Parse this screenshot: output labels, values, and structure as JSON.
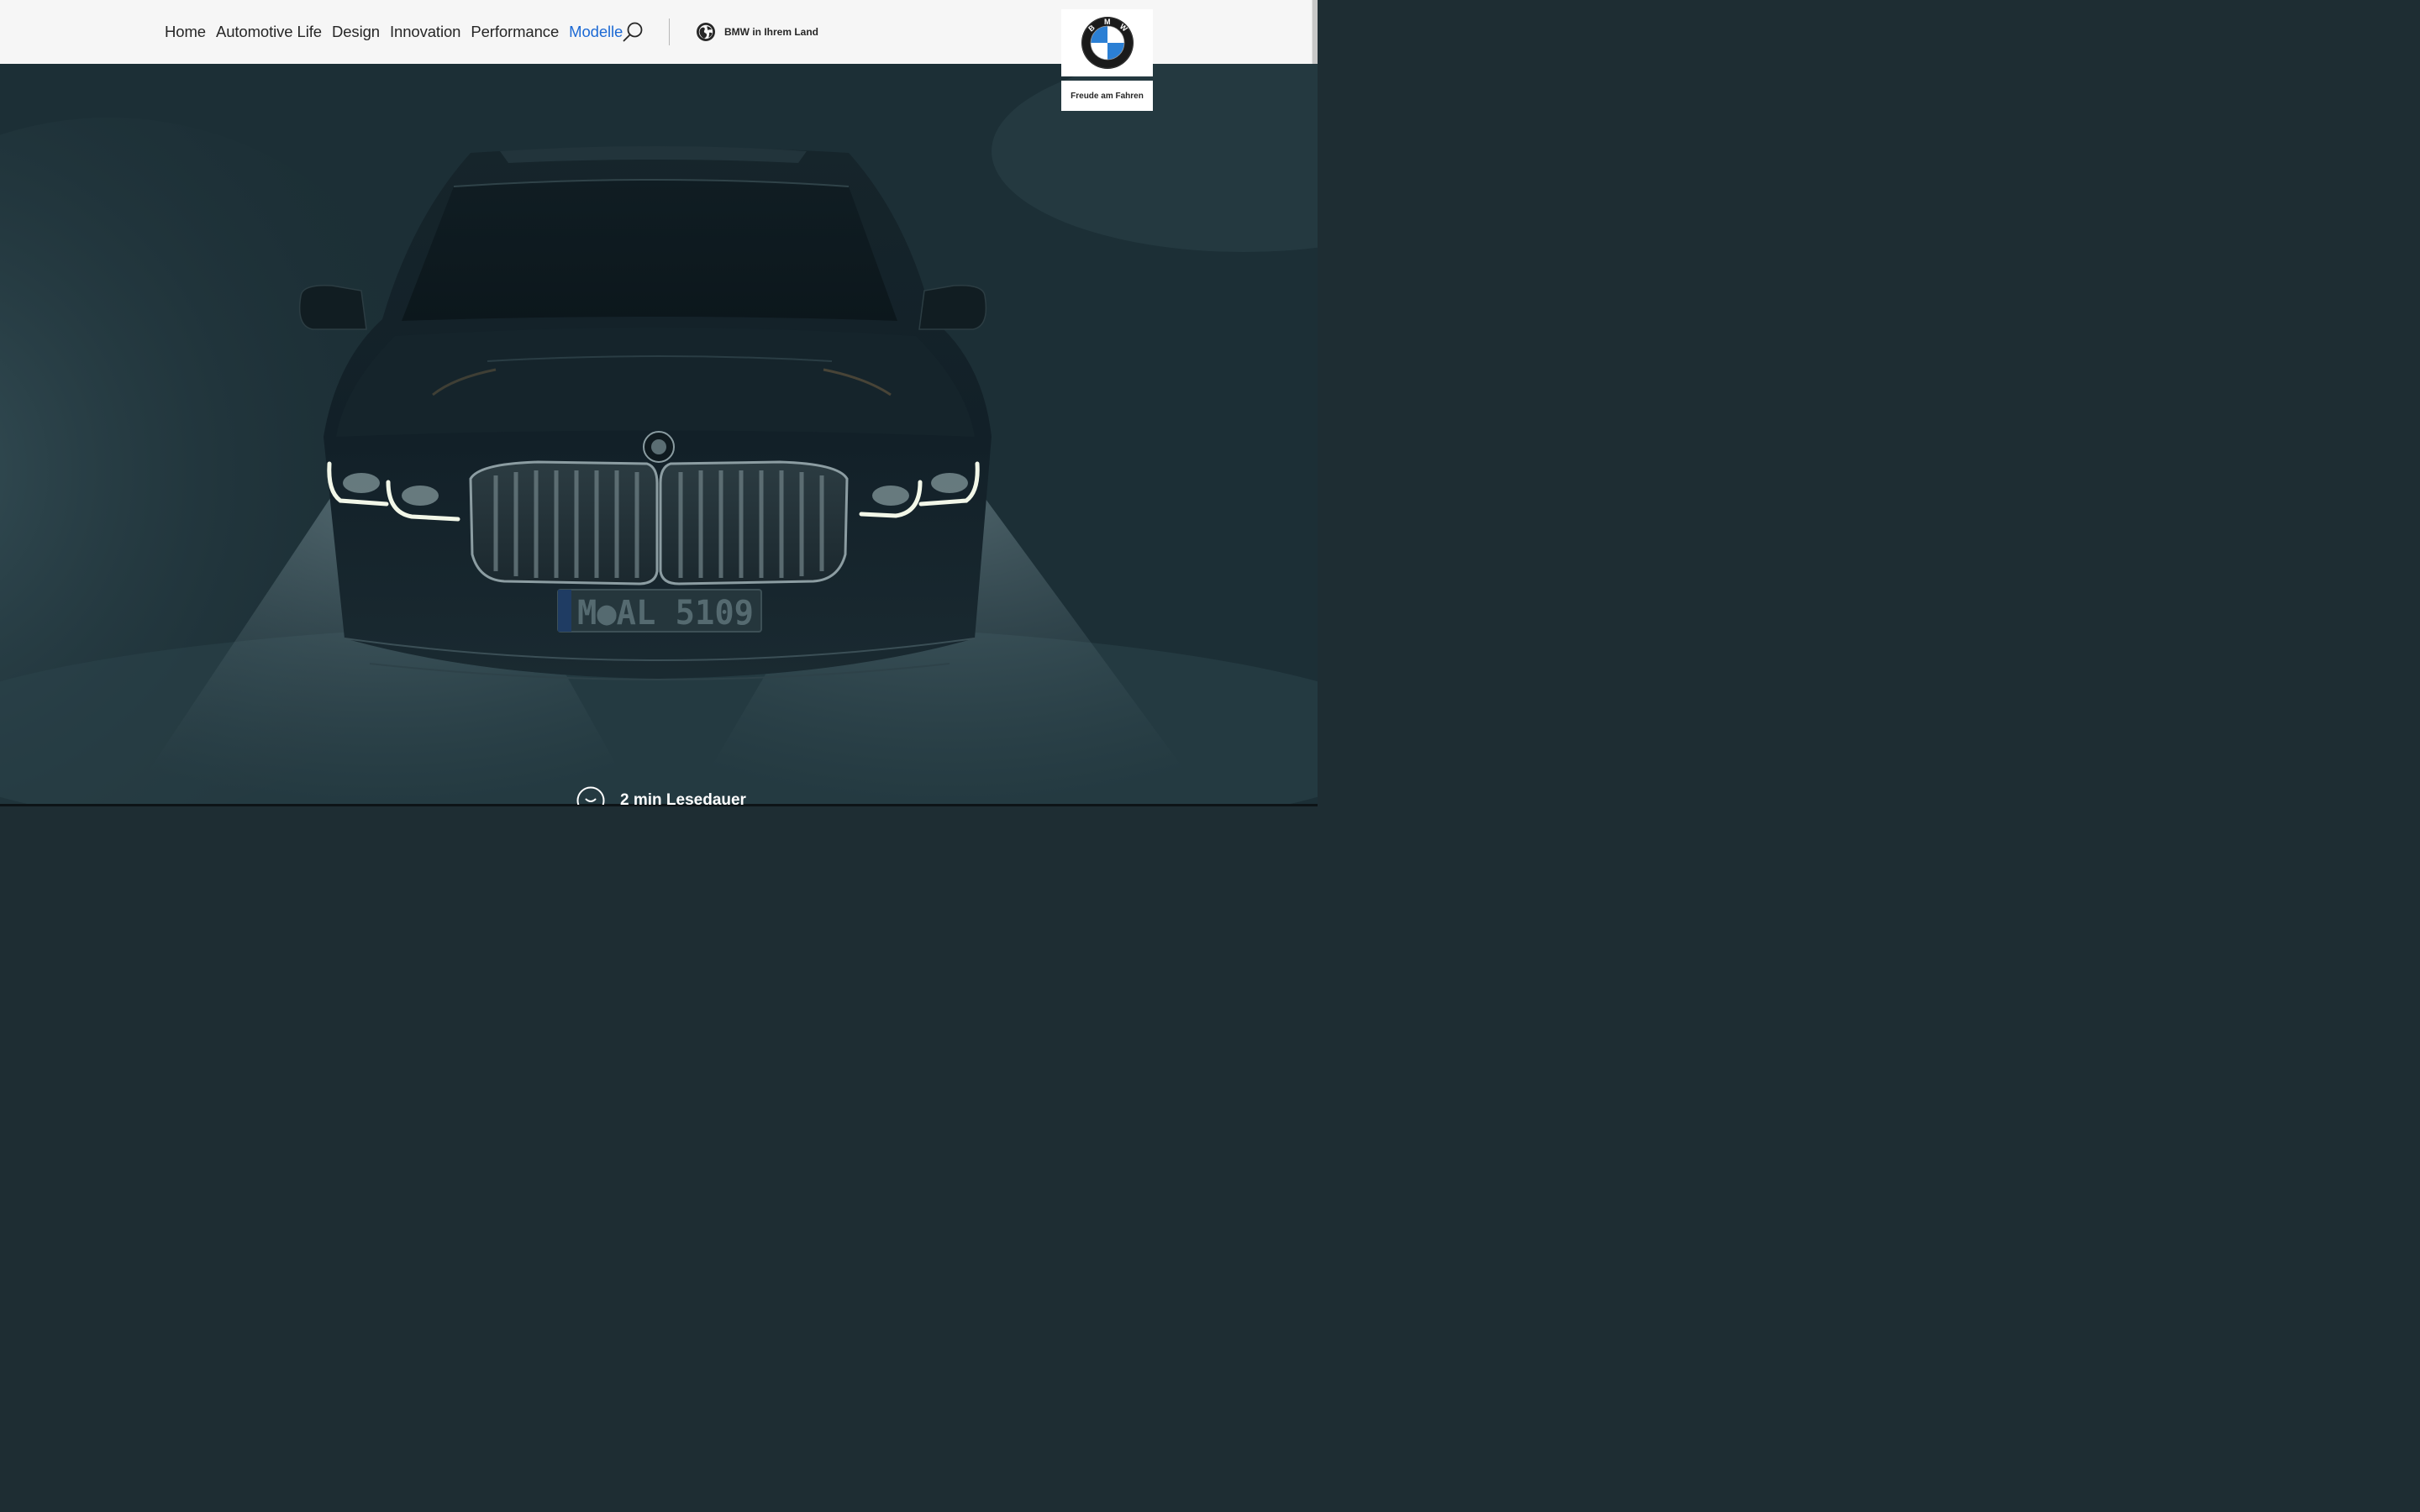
{
  "nav": {
    "items": [
      {
        "label": "Home",
        "active": false
      },
      {
        "label": "Automotive Life",
        "active": false
      },
      {
        "label": "Design",
        "active": false
      },
      {
        "label": "Innovation",
        "active": false
      },
      {
        "label": "Performance",
        "active": false
      },
      {
        "label": "Modelle",
        "active": true
      }
    ],
    "search_icon": "search-icon",
    "country_icon": "globe-icon",
    "country_label": "BMW in Ihrem Land"
  },
  "brand": {
    "logo_letters": "BMW",
    "tagline": "Freude am Fahren"
  },
  "hero": {
    "license_plate": "M●AL 5109",
    "reading_icon": "clock-icon",
    "reading_time": "2 min Lesedauer"
  },
  "colors": {
    "accent": "#1c69d4",
    "header_bg": "#f6f6f6",
    "hero_bg": "#1c2f36",
    "text_dark": "#262626",
    "text_light": "#ffffff"
  }
}
